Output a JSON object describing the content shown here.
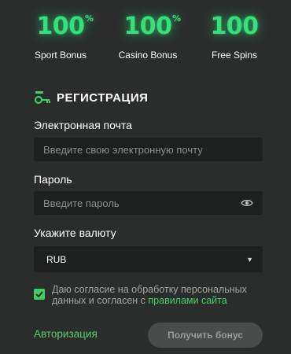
{
  "bonuses": [
    {
      "value": "100",
      "suffix": "%",
      "caption": "Sport Bonus"
    },
    {
      "value": "100",
      "suffix": "%",
      "caption": "Casino Bonus"
    },
    {
      "value": "100",
      "suffix": "",
      "caption": "Free Spins"
    }
  ],
  "registration": {
    "title": "РЕГИСТРАЦИЯ"
  },
  "email": {
    "label": "Электронная почта",
    "placeholder": "Введите свою электронную почту"
  },
  "password": {
    "label": "Пароль",
    "placeholder": "Введите пароль"
  },
  "currency": {
    "label": "Укажите валюту",
    "selected": "RUB"
  },
  "consent": {
    "checked": true,
    "text_before": "Даю согласие на обработку персональных данных и согласен с ",
    "link_text": "правилами сайта"
  },
  "footer": {
    "login_link": "Авторизация",
    "submit_label": "Получить бонус"
  },
  "colors": {
    "accent": "#33e07a",
    "background": "#2b2d2c",
    "field": "#1e201f",
    "button_disabled": "#4a4c4b"
  }
}
